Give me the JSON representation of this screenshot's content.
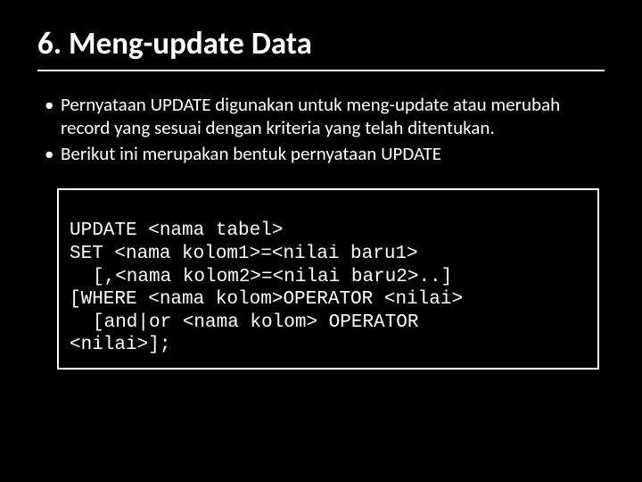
{
  "title": "6. Meng-update Data",
  "bullets": [
    "Pernyataan UPDATE digunakan untuk meng-update atau merubah record yang sesuai dengan kriteria yang telah ditentukan.",
    "Berikut ini merupakan bentuk pernyataan UPDATE"
  ],
  "code": {
    "line1": "UPDATE <nama tabel>",
    "line2": "SET <nama kolom1>=<nilai baru1>",
    "line3": "[,<nama kolom2>=<nilai baru2>..]",
    "line4": "[WHERE <nama kolom>OPERATOR <nilai>",
    "line5": "[and|or <nama kolom> OPERATOR",
    "line6": "<nilai>];"
  }
}
